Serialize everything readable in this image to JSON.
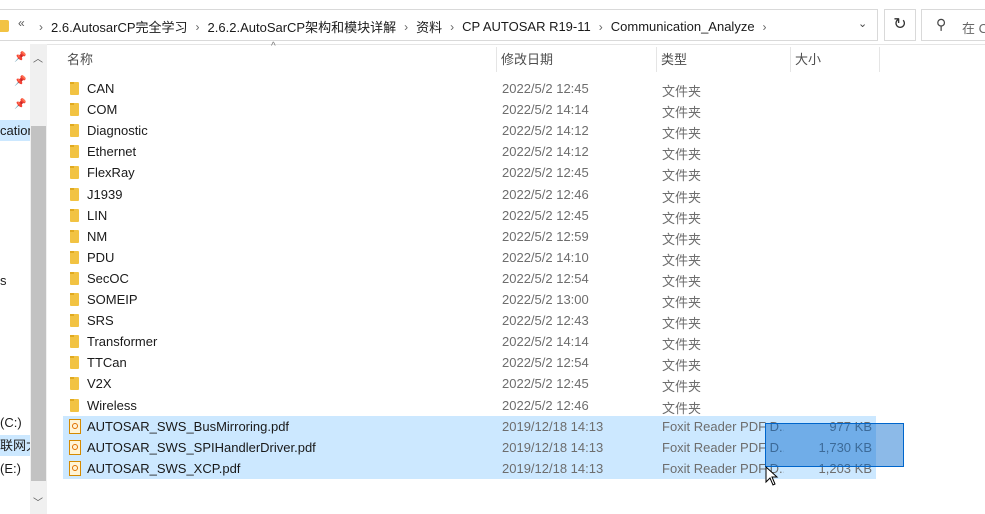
{
  "address_bar": {
    "overflow_glyph": "«",
    "breadcrumbs": [
      "2.6.AutosarCP完全学习",
      "2.6.2.AutoSarCP架构和模块详解",
      "资料",
      "CP AUTOSAR R19-11",
      "Communication_Analyze"
    ],
    "separator": "›",
    "dropdown_glyph": "⌄",
    "refresh_glyph": "↻",
    "search_icon": "search-icon",
    "search_placeholder": "在 C"
  },
  "nav_pane": {
    "items": [
      {
        "text": "cation",
        "selected": true
      },
      {
        "text": "s",
        "selected": false
      },
      {
        "text": "(C:)",
        "selected": false
      },
      {
        "text": "联网大",
        "selected": true
      },
      {
        "text": "(E:)",
        "selected": false
      }
    ]
  },
  "columns": {
    "name": "名称",
    "date": "修改日期",
    "type": "类型",
    "size": "大小"
  },
  "files": [
    {
      "name": "CAN",
      "date": "2022/5/2 12:45",
      "type": "文件夹",
      "size": "",
      "kind": "folder",
      "selected": false
    },
    {
      "name": "COM",
      "date": "2022/5/2 14:14",
      "type": "文件夹",
      "size": "",
      "kind": "folder",
      "selected": false
    },
    {
      "name": "Diagnostic",
      "date": "2022/5/2 14:12",
      "type": "文件夹",
      "size": "",
      "kind": "folder",
      "selected": false
    },
    {
      "name": "Ethernet",
      "date": "2022/5/2 14:12",
      "type": "文件夹",
      "size": "",
      "kind": "folder",
      "selected": false
    },
    {
      "name": "FlexRay",
      "date": "2022/5/2 12:45",
      "type": "文件夹",
      "size": "",
      "kind": "folder",
      "selected": false
    },
    {
      "name": "J1939",
      "date": "2022/5/2 12:46",
      "type": "文件夹",
      "size": "",
      "kind": "folder",
      "selected": false
    },
    {
      "name": "LIN",
      "date": "2022/5/2 12:45",
      "type": "文件夹",
      "size": "",
      "kind": "folder",
      "selected": false
    },
    {
      "name": "NM",
      "date": "2022/5/2 12:59",
      "type": "文件夹",
      "size": "",
      "kind": "folder",
      "selected": false
    },
    {
      "name": "PDU",
      "date": "2022/5/2 14:10",
      "type": "文件夹",
      "size": "",
      "kind": "folder",
      "selected": false
    },
    {
      "name": "SecOC",
      "date": "2022/5/2 12:54",
      "type": "文件夹",
      "size": "",
      "kind": "folder",
      "selected": false
    },
    {
      "name": "SOMEIP",
      "date": "2022/5/2 13:00",
      "type": "文件夹",
      "size": "",
      "kind": "folder",
      "selected": false
    },
    {
      "name": "SRS",
      "date": "2022/5/2 12:43",
      "type": "文件夹",
      "size": "",
      "kind": "folder",
      "selected": false
    },
    {
      "name": "Transformer",
      "date": "2022/5/2 14:14",
      "type": "文件夹",
      "size": "",
      "kind": "folder",
      "selected": false
    },
    {
      "name": "TTCan",
      "date": "2022/5/2 12:54",
      "type": "文件夹",
      "size": "",
      "kind": "folder",
      "selected": false
    },
    {
      "name": "V2X",
      "date": "2022/5/2 12:45",
      "type": "文件夹",
      "size": "",
      "kind": "folder",
      "selected": false
    },
    {
      "name": "Wireless",
      "date": "2022/5/2 12:46",
      "type": "文件夹",
      "size": "",
      "kind": "folder",
      "selected": false
    },
    {
      "name": "AUTOSAR_SWS_BusMirroring.pdf",
      "date": "2019/12/18 14:13",
      "type": "Foxit Reader PDF D...",
      "size": "977 KB",
      "kind": "pdf",
      "selected": true
    },
    {
      "name": "AUTOSAR_SWS_SPIHandlerDriver.pdf",
      "date": "2019/12/18 14:13",
      "type": "Foxit Reader PDF D...",
      "size": "1,730 KB",
      "kind": "pdf",
      "selected": true
    },
    {
      "name": "AUTOSAR_SWS_XCP.pdf",
      "date": "2019/12/18 14:13",
      "type": "Foxit Reader PDF D...",
      "size": "1,203 KB",
      "kind": "pdf",
      "selected": true
    }
  ],
  "colors": {
    "selection": "#cce8ff",
    "marquee": "#0066cc",
    "folder": "#f2c343"
  }
}
